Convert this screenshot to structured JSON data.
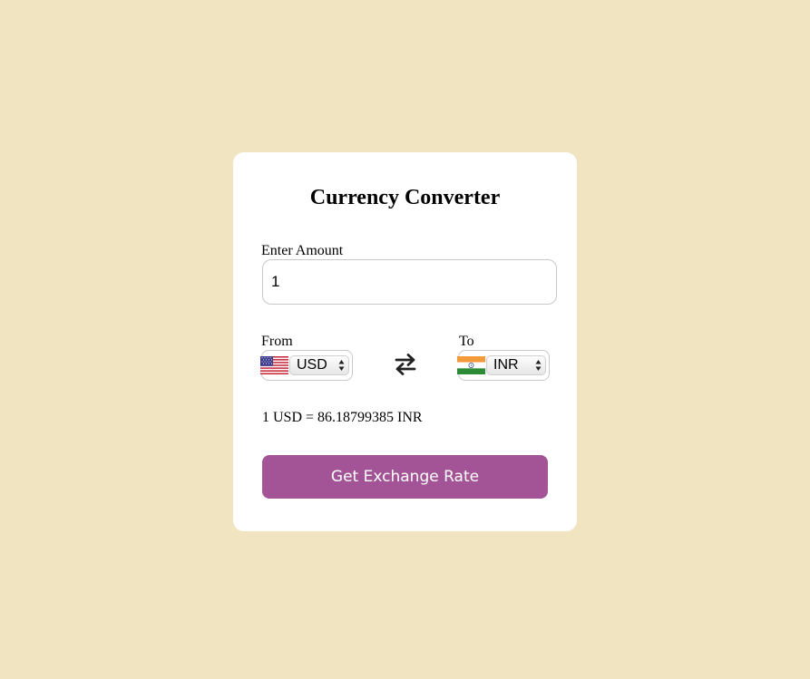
{
  "app": {
    "title": "Currency Converter"
  },
  "amount": {
    "label": "Enter Amount",
    "value": "1"
  },
  "from": {
    "label": "From",
    "currency": "USD",
    "flag_icon": "us-flag-icon"
  },
  "to": {
    "label": "To",
    "currency": "INR",
    "flag_icon": "india-flag-icon"
  },
  "swap": {
    "icon": "swap-arrows-icon"
  },
  "result": {
    "text": "1 USD = 86.18799385 INR"
  },
  "button": {
    "label": "Get Exchange Rate"
  },
  "colors": {
    "page_background": "#f0e4c1",
    "card_background": "#ffffff",
    "button_background": "#a35496",
    "button_text": "#ffffff"
  }
}
